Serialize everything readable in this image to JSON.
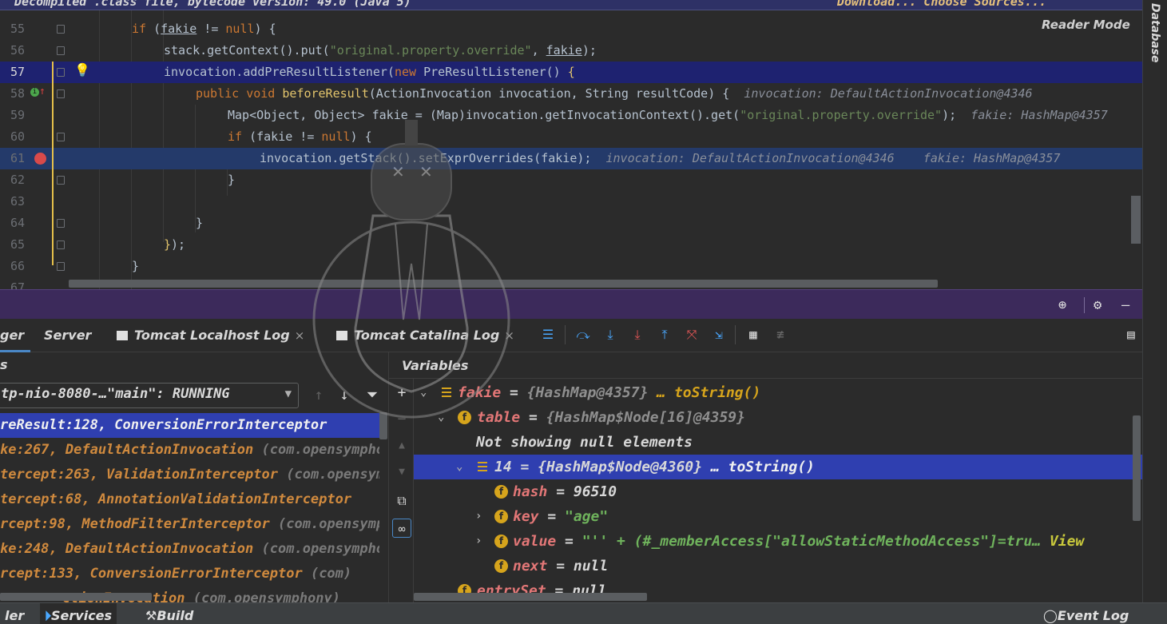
{
  "banner": {
    "left_text": "Decompiled .class file, bytecode version: 49.0 (Java 5)",
    "right_text": "Download...  Choose Sources..."
  },
  "right_stripe": {
    "label": "Database"
  },
  "editor": {
    "reader_mode": "Reader Mode",
    "lines": [
      {
        "num": "55",
        "text": "if (fakie != null) {"
      },
      {
        "num": "56",
        "text": "stack.getContext().put(\"original.property.override\", fakie);"
      },
      {
        "num": "57",
        "text": "invocation.addPreResultListener(new PreResultListener() {"
      },
      {
        "num": "58",
        "text": "public void beforeResult(ActionInvocation invocation, String resultCode) {",
        "hint": "invocation: DefaultActionInvocation@4346"
      },
      {
        "num": "59",
        "text": "Map<Object, Object> fakie = (Map)invocation.getInvocationContext().get(\"original.property.override\");",
        "hint": "fakie: HashMap@4357"
      },
      {
        "num": "60",
        "text": "if (fakie != null) {"
      },
      {
        "num": "61",
        "text": "invocation.getStack().setExprOverrides(fakie);",
        "hint": "invocation: DefaultActionInvocation@4346    fakie: HashMap@4357"
      },
      {
        "num": "62",
        "text": "}"
      },
      {
        "num": "63",
        "text": ""
      },
      {
        "num": "64",
        "text": "}"
      },
      {
        "num": "65",
        "text": "});"
      },
      {
        "num": "66",
        "text": "}"
      },
      {
        "num": "67",
        "text": ""
      }
    ]
  },
  "tabs": {
    "debugger": "ger",
    "server": "Server",
    "localhost_log": "Tomcat Localhost Log",
    "catalina_log": "Tomcat Catalina Log",
    "close": "×"
  },
  "frames": {
    "title": "s",
    "thread": "tp-nio-8080-…\"main\": RUNNING",
    "items": [
      {
        "method": "reResult:128, ConversionErrorInterceptor",
        "pkg": ""
      },
      {
        "method": "ke:267, DefaultActionInvocation",
        "pkg": "(com.opensymphony.xwork2)"
      },
      {
        "method": "tercept:263, ValidationInterceptor",
        "pkg": "(com.opensymphony)"
      },
      {
        "method": "tercept:68, AnnotationValidationInterceptor",
        "pkg": ""
      },
      {
        "method": "rcept:98, MethodFilterInterceptor",
        "pkg": "(com.opensymphony)"
      },
      {
        "method": "ke:248, DefaultActionInvocation",
        "pkg": "(com.opensymphony)"
      },
      {
        "method": "rcept:133, ConversionErrorInterceptor",
        "pkg": "(com)"
      },
      {
        "method": "ctionInvocation",
        "pkg": "(com.opensymphony)"
      }
    ]
  },
  "variables": {
    "title": "Variables",
    "rows": [
      {
        "name": "fakie",
        "value": "{HashMap@4357}",
        "extra": "… toString()"
      },
      {
        "name": "table",
        "value": "{HashMap$Node[16]@4359}",
        "extra": ""
      },
      {
        "name": "",
        "value": "Not showing null elements",
        "extra": ""
      },
      {
        "name": "14",
        "value": "{HashMap$Node@4360}",
        "extra": "… toString()"
      },
      {
        "name": "hash",
        "value": "96510",
        "extra": ""
      },
      {
        "name": "key",
        "value": "\"age\"",
        "extra": ""
      },
      {
        "name": "value",
        "value": "\"'' + (#_memberAccess[\"allowStaticMethodAccess\"]=tru…",
        "extra": "View"
      },
      {
        "name": "next",
        "value": "null",
        "extra": ""
      },
      {
        "name": "entrySet",
        "value": "null",
        "extra": ""
      }
    ]
  },
  "statusbar": {
    "profiler": "ler",
    "services": "Services",
    "build": "Build",
    "event_log": "Event Log"
  },
  "colors": {
    "highlight": "#1e2270",
    "selection": "#2f3fb0",
    "tool_header": "#3c2a5b",
    "keyword": "#cc7832",
    "string": "#6a8759"
  }
}
